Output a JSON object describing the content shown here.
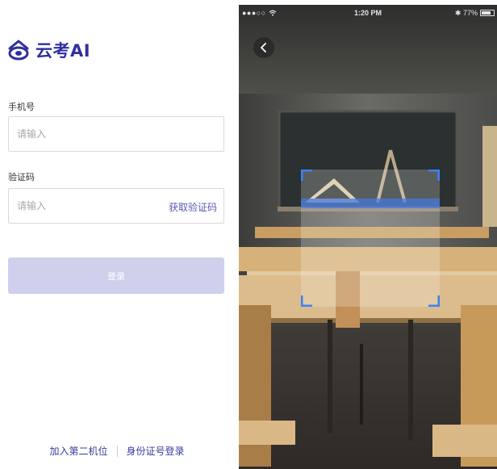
{
  "login": {
    "brand_name": "云考AI",
    "phone_label": "手机号",
    "phone_placeholder": "请输入",
    "code_label": "验证码",
    "code_placeholder": "请输入",
    "get_code_label": "获取验证码",
    "login_button_label": "登录",
    "footer_links": [
      "加入第二机位",
      "身份证号登录"
    ],
    "accent_color": "#2f2f9e",
    "button_color": "#cfd0ec"
  },
  "camera": {
    "status": {
      "signal": "●●●○○",
      "wifi_icon": "wifi-icon",
      "time": "1:20 PM",
      "battery_text": "77%",
      "battery_level": 0.77
    },
    "back_icon": "chevron-left-icon",
    "scan_frame_color": "#3b82f6"
  }
}
